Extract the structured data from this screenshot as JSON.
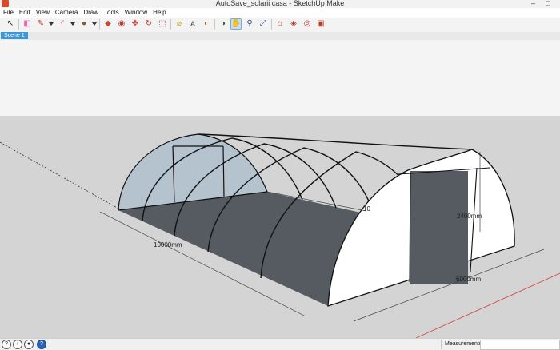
{
  "window": {
    "title": "AutoSave_solarii casa - SketchUp Make",
    "minimize_glyph": "–",
    "maximize_glyph": "□"
  },
  "menu": [
    "File",
    "Edit",
    "View",
    "Camera",
    "Draw",
    "Tools",
    "Window",
    "Help"
  ],
  "toolbar": {
    "tools": [
      {
        "name": "select-tool",
        "glyph": "↖"
      },
      {
        "name": "eraser-tool",
        "glyph": "◧"
      },
      {
        "name": "pencil-tool",
        "glyph": "✎"
      },
      {
        "name": "arc-tool",
        "glyph": "◜"
      },
      {
        "name": "shapes-tool",
        "glyph": "●"
      },
      {
        "name": "push-pull-tool",
        "glyph": "◆"
      },
      {
        "name": "follow-me-tool",
        "glyph": "◉"
      },
      {
        "name": "move-tool",
        "glyph": "✥"
      },
      {
        "name": "rotate-tool",
        "glyph": "↻"
      },
      {
        "name": "scale-tool",
        "glyph": "⬚"
      },
      {
        "name": "tape-measure-tool",
        "glyph": "⌀"
      },
      {
        "name": "text-tool",
        "glyph": "A"
      },
      {
        "name": "paint-bucket-tool",
        "glyph": "◐"
      },
      {
        "name": "orbit-tool",
        "glyph": "◑"
      },
      {
        "name": "pan-tool",
        "glyph": "✋"
      },
      {
        "name": "zoom-tool",
        "glyph": "⚲"
      },
      {
        "name": "zoom-extents-tool",
        "glyph": "⤢"
      },
      {
        "name": "3d-warehouse-tool",
        "glyph": "⌂"
      },
      {
        "name": "extension-warehouse-tool",
        "glyph": "◈"
      },
      {
        "name": "share-model-tool",
        "glyph": "◎"
      },
      {
        "name": "layout-tool",
        "glyph": "▣"
      }
    ],
    "active_tool": "pan-tool"
  },
  "scenes": [
    {
      "label": "Scene 1",
      "active": true
    }
  ],
  "model": {
    "dimensions": {
      "length": "10000mm",
      "width": "6000mm",
      "height": "2400mm",
      "hidden_length": "10"
    },
    "colors": {
      "sky": "#f4f4f4",
      "ground": "#d4d4d4",
      "floor": "#555b61",
      "end_wall": "#ffffff",
      "back_wall": "#b5c3cf",
      "frame": "#111111",
      "axis_red": "#d24a4a"
    }
  },
  "status": {
    "icons": [
      "geo-location-icon",
      "credits-icon",
      "user-icon",
      "help-icon"
    ],
    "measurements_label": "Measurements",
    "measurements_value": ""
  }
}
